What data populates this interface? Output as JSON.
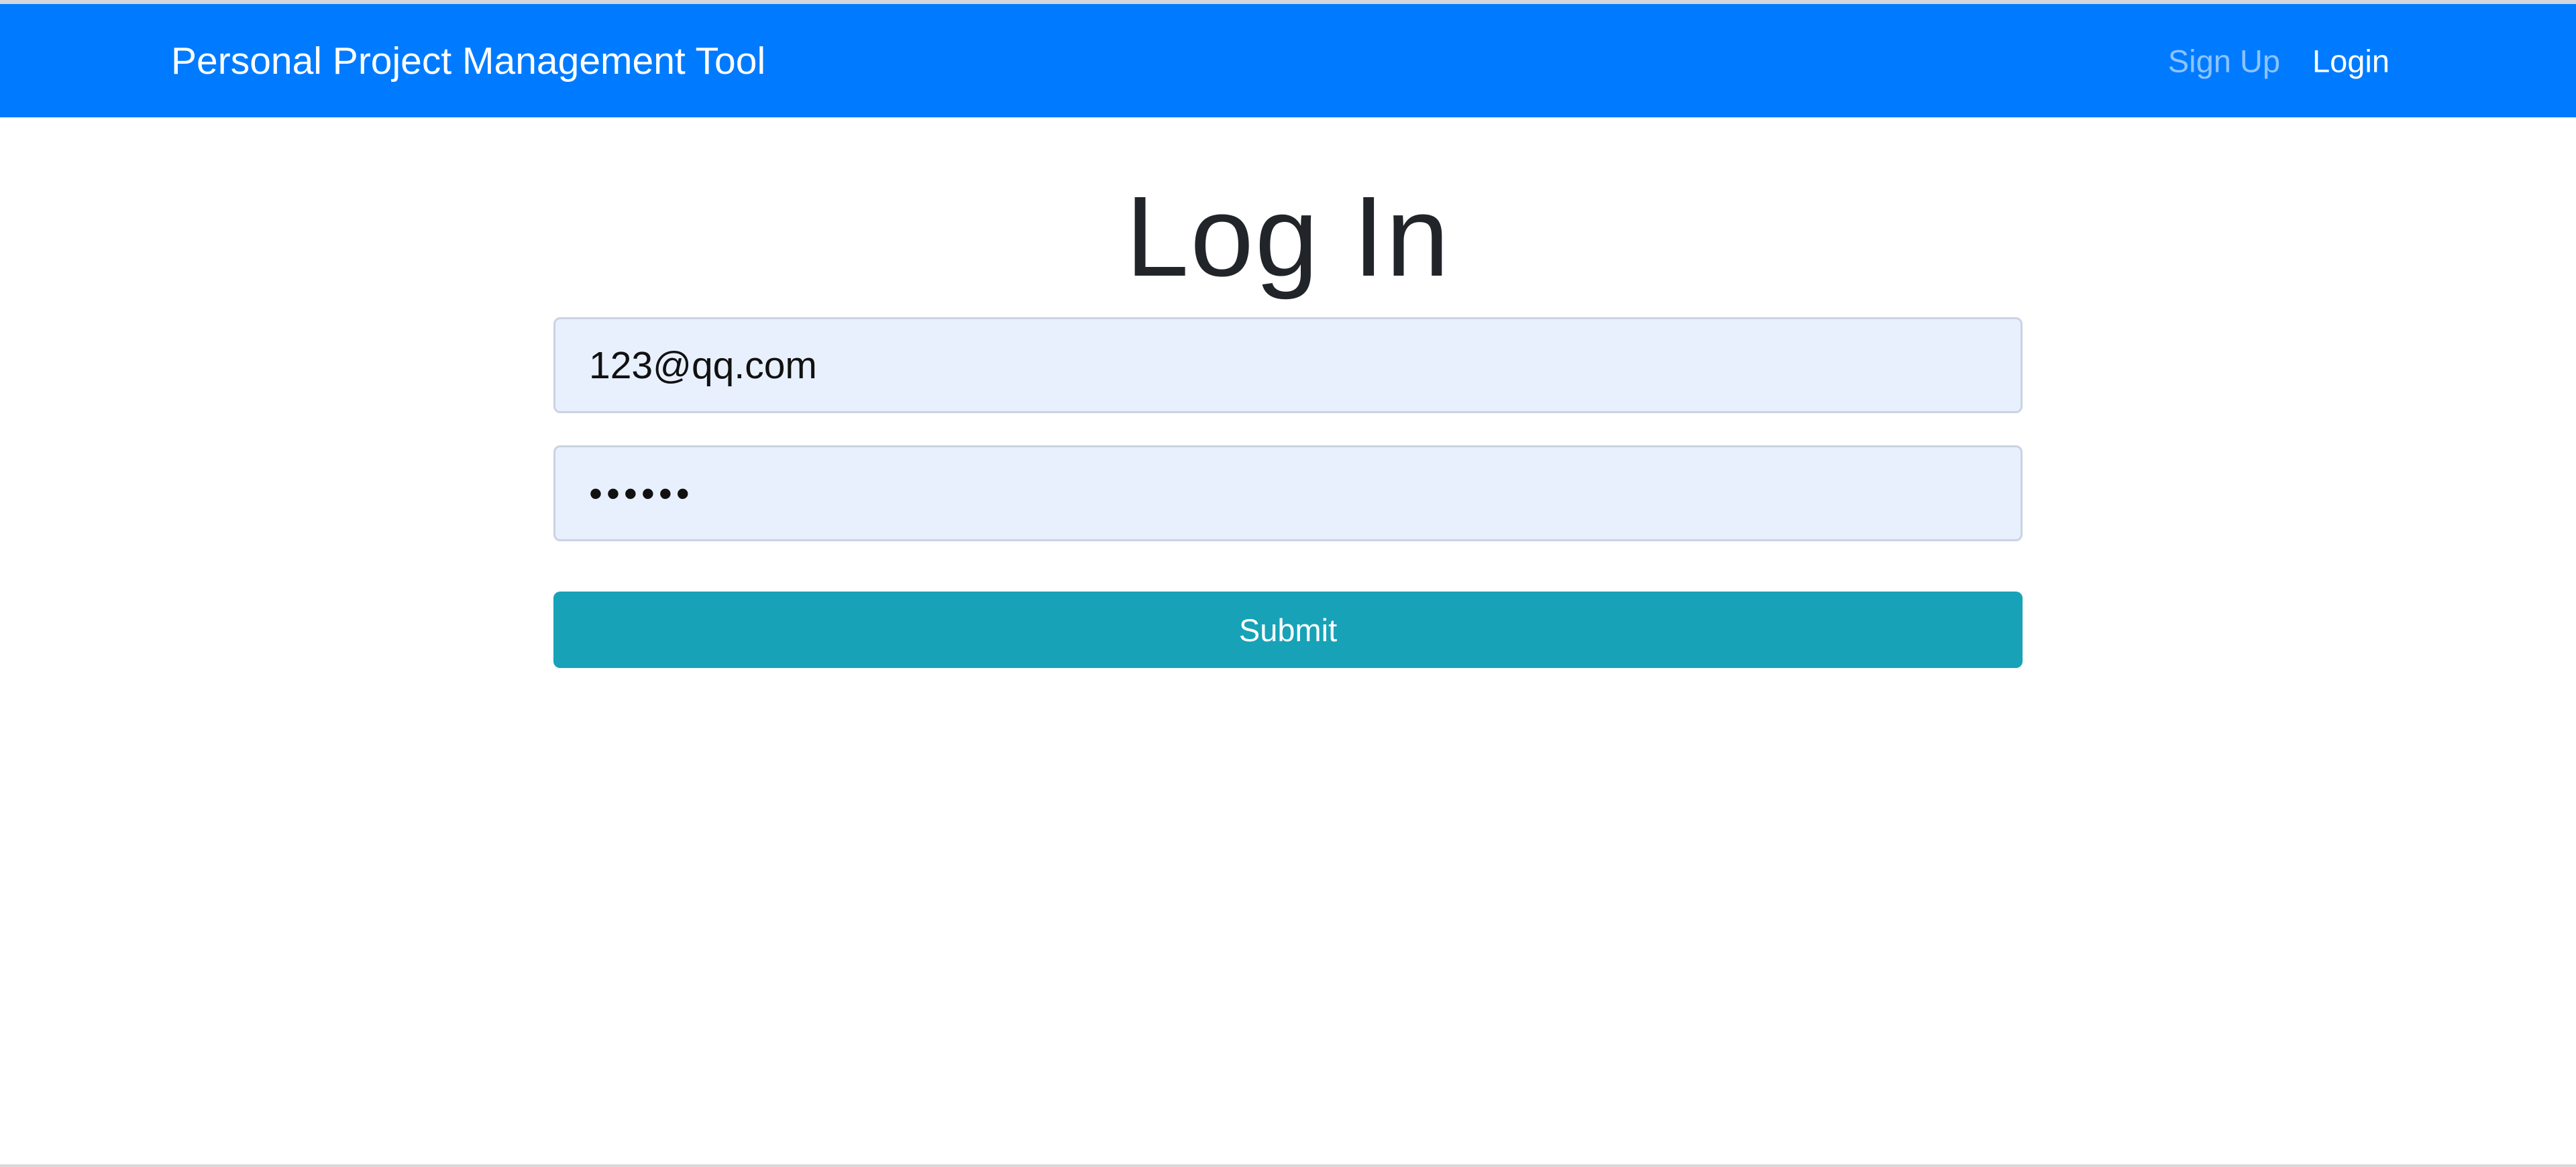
{
  "navbar": {
    "brand": "Personal Project Management Tool",
    "links": [
      {
        "label": "Sign Up"
      },
      {
        "label": "Login"
      }
    ],
    "background_color": "#007bff"
  },
  "main": {
    "title": "Log In",
    "email_field": {
      "value": "123@qq.com"
    },
    "password_field": {
      "value": "••••••"
    },
    "submit_label": "Submit",
    "submit_color": "#17a2b8"
  }
}
